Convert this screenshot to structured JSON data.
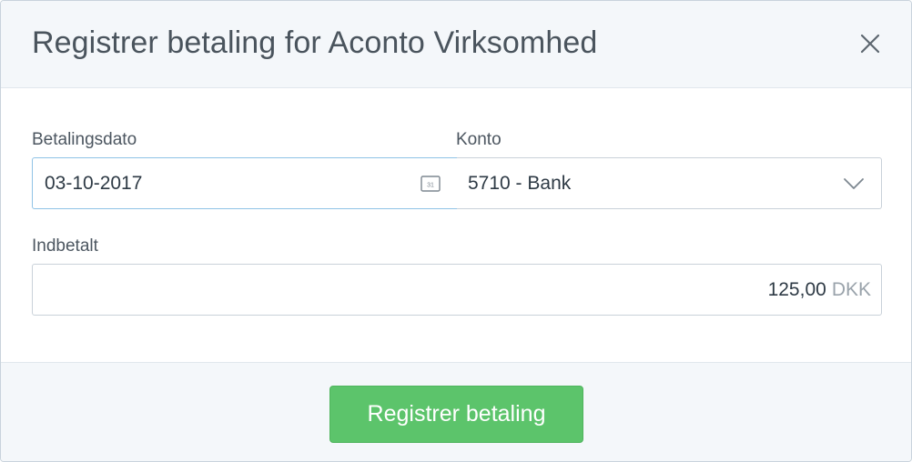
{
  "header": {
    "title": "Registrer betaling for Aconto Virksomhed",
    "close_icon": "close-icon"
  },
  "form": {
    "date_label": "Betalingsdato",
    "date_value": "03-10-2017",
    "calendar_icon_text": "31",
    "account_label": "Konto",
    "account_value": "5710 - Bank",
    "amount_label": "Indbetalt",
    "amount_value": "125,00",
    "amount_currency": "DKK"
  },
  "footer": {
    "submit_label": "Registrer betaling"
  },
  "colors": {
    "submit_button": "#5cc46b",
    "header_bg": "#f4f7fa",
    "focus_border": "#8fc3e6"
  }
}
